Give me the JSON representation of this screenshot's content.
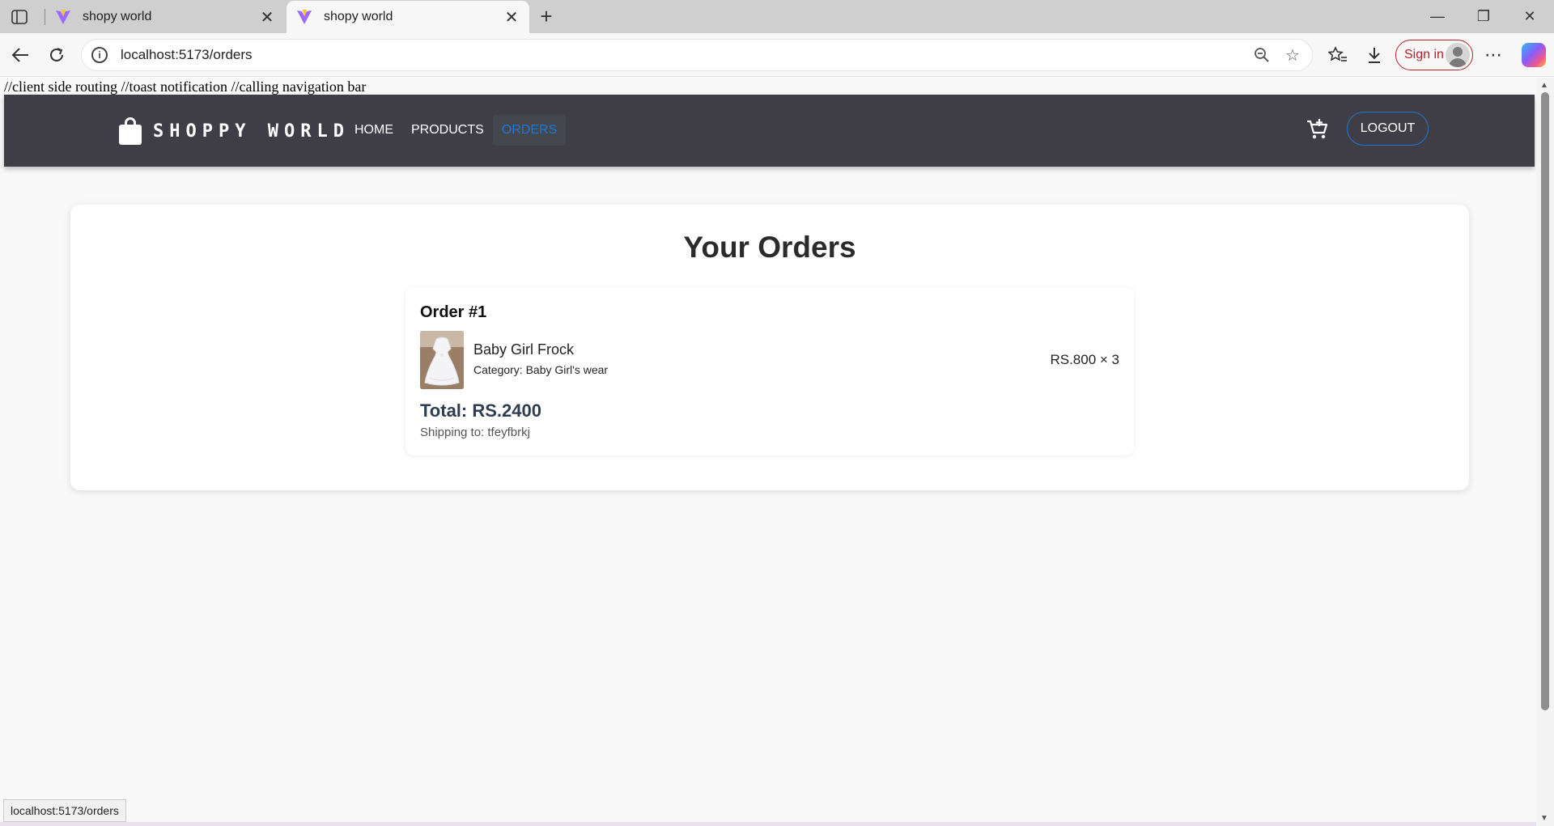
{
  "browser": {
    "tabs": [
      {
        "title": "shopy world",
        "active": false
      },
      {
        "title": "shopy world",
        "active": true
      }
    ],
    "url": "localhost:5173/orders",
    "signin_label": "Sign in",
    "status_url": "localhost:5173/orders",
    "icons": {
      "sidebar": "sidebar-toggle-icon",
      "back": "back-arrow-icon",
      "reload": "reload-icon",
      "info": "site-info-icon",
      "zoom": "zoom-out-icon",
      "favorite": "star-icon",
      "favorites": "favorites-icon",
      "downloads": "download-icon",
      "more": "more-icon",
      "copilot": "copilot-icon"
    }
  },
  "page": {
    "debug_text": "//client side routing //toast notification //calling navigation bar",
    "navbar": {
      "brand": "SHOPPY WORLD",
      "links": [
        "HOME",
        "PRODUCTS",
        "ORDERS"
      ],
      "active_link": "ORDERS",
      "logout_label": "LOGOUT"
    },
    "orders": {
      "title": "Your Orders",
      "items": [
        {
          "order_label": "Order #1",
          "product_name": "Baby Girl Frock",
          "category": "Category: Baby Girl's wear",
          "price_qty": "RS.800 × 3",
          "total": "Total: RS.2400",
          "shipping": "Shipping to: tfeyfbrkj"
        }
      ]
    }
  },
  "colors": {
    "navbar_bg": "#3f3e47",
    "accent": "#1f78d1",
    "page_bg": "#f9f9f9"
  }
}
